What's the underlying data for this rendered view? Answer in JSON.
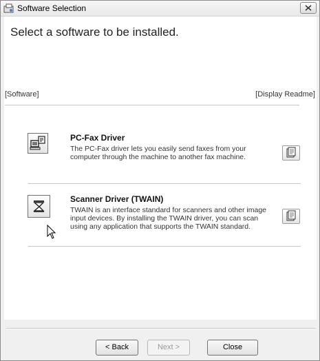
{
  "window": {
    "title": "Software Selection"
  },
  "header": {
    "title": "Select a software to be installed."
  },
  "columns": {
    "left": "[Software]",
    "right": "[Display Readme]"
  },
  "items": [
    {
      "title": "PC-Fax Driver",
      "description": "The PC-Fax driver lets you easily send faxes from your computer through the machine to another fax machine.",
      "icon": "fax-computer-icon"
    },
    {
      "title": "Scanner Driver (TWAIN)",
      "description": "TWAIN is an interface standard for scanners and other image input devices. By installing the TWAIN driver, you can scan using any application that supports the TWAIN standard.",
      "icon": "scanner-icon"
    }
  ],
  "footer": {
    "back": "< Back",
    "next": "Next >",
    "close": "Close"
  }
}
